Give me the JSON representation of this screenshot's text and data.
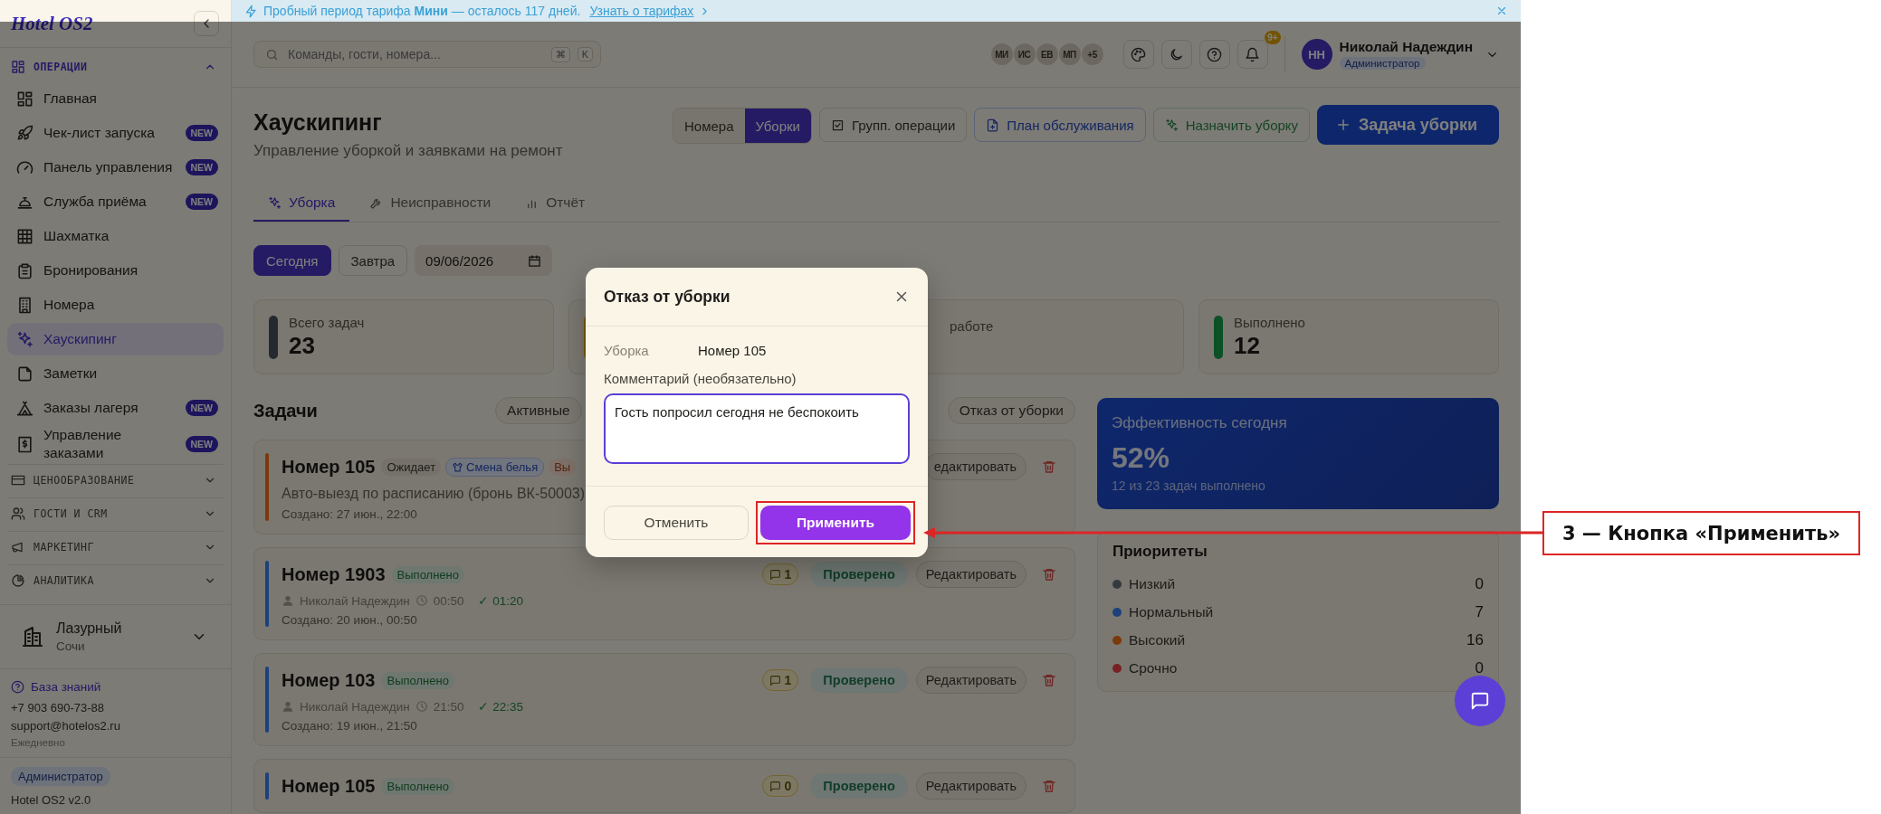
{
  "banner": {
    "text": "Пробный период тарифа **Мини** — осталось 117 дней.",
    "link": "Узнать о тарифах"
  },
  "sidebar": {
    "logo": "Hotel OS2",
    "sections": [
      {
        "label": "ОПЕРАЦИИ",
        "expanded": true,
        "items": [
          {
            "label": "Главная",
            "selected": false
          },
          {
            "label": "Чек-лист запуска",
            "badge": "NEW",
            "selected": false
          },
          {
            "label": "Панель управления",
            "badge": "NEW",
            "selected": false
          },
          {
            "label": "Служба приёма",
            "badge": "NEW",
            "selected": false
          },
          {
            "label": "Шахматка",
            "selected": false
          },
          {
            "label": "Бронирования",
            "selected": false
          },
          {
            "label": "Номера",
            "selected": false
          },
          {
            "label": "Хаускипинг",
            "selected": true
          },
          {
            "label": "Заметки",
            "selected": false
          },
          {
            "label": "Заказы лагеря",
            "badge": "NEW",
            "selected": false
          },
          {
            "label": "Управление заказами",
            "badge": "NEW",
            "selected": false
          }
        ]
      },
      {
        "label": "ЦЕНООБРАЗОВАНИЕ",
        "expanded": false
      },
      {
        "label": "ГОСТИ И CRM",
        "expanded": false
      },
      {
        "label": "МАРКЕТИНГ",
        "expanded": false
      },
      {
        "label": "АНАЛИТИКА",
        "expanded": false
      }
    ],
    "hotel": {
      "name": "Лазурный",
      "city": "Сочи"
    },
    "support": {
      "link": "База знаний",
      "phone": "+7 903 690-73-88",
      "email": "support@hotelos2.ru",
      "hours": "Ежедневно"
    },
    "role": "Администратор",
    "version": "Hotel OS2 v2.0"
  },
  "topbar": {
    "search": {
      "placeholder": "Команды, гости, номера...",
      "keys": [
        "⌘",
        "K"
      ]
    },
    "users": [
      "МИ",
      "ИС",
      "ЕВ",
      "МП",
      "+5"
    ],
    "notifications": "9+",
    "user": {
      "initials": "НН",
      "name": "Николай Надеждин",
      "role": "Администратор"
    }
  },
  "header": {
    "title": "Хаускипинг",
    "subtitle": "Управление уборкой и заявками на ремонт"
  },
  "view_toggle": [
    {
      "label": "Номера",
      "selected": false
    },
    {
      "label": "Уборки",
      "selected": true
    }
  ],
  "actions": [
    {
      "label": "Групп. операции",
      "kind": "outline"
    },
    {
      "label": "План обслуживания",
      "kind": "blue"
    },
    {
      "label": "Назначить уборку",
      "kind": "green"
    },
    {
      "label": "Задача уборки",
      "kind": "primary"
    }
  ],
  "tabs": [
    {
      "label": "Уборка",
      "selected": true
    },
    {
      "label": "Неисправности",
      "selected": false
    },
    {
      "label": "Отчёт",
      "selected": false
    }
  ],
  "days": [
    {
      "label": "Сегодня",
      "selected": true
    },
    {
      "label": "Завтра",
      "selected": false
    }
  ],
  "date": {
    "value": "09/06/2026"
  },
  "stats": [
    {
      "label": "Всего задач",
      "value": "23",
      "color": "#252a31"
    },
    {
      "color": "#755a04"
    },
    {
      "label": "работе",
      "kind": "partial"
    },
    {
      "label": "Выполнено",
      "value": "12",
      "color": "#0b5125"
    }
  ],
  "tasks_title": "Задачи",
  "filters": [
    "Активные",
    "Отказ от уборки"
  ],
  "tasks": [
    {
      "title": "Номер 105",
      "color": "#7c390b",
      "badges": [
        {
          "label": "Ожидает",
          "kind": "waiting"
        },
        {
          "label": "Смена белья",
          "kind": "type"
        },
        {
          "label": "Вы",
          "kind": "priority"
        }
      ],
      "description": "Авто-выезд по расписанию (бронь ВК-50003)",
      "created": "Создано: 27 июн., 22:00",
      "edit": "едактировать"
    },
    {
      "title": "Номер 1903",
      "color": "#1d417b",
      "badges": [
        {
          "label": "Выполнено",
          "kind": "done"
        }
      ],
      "assignee": "Николай Надеждин",
      "start": "00:50",
      "finish": "✓ 01:20",
      "created": "Создано: 20 июн., 00:50",
      "comments": "1",
      "verified": "Проверено",
      "edit": "Редактировать"
    },
    {
      "title": "Номер 103",
      "color": "#1d417b",
      "badges": [
        {
          "label": "Выполнено",
          "kind": "done"
        }
      ],
      "assignee": "Николай Надеждин",
      "start": "21:50",
      "finish": "✓ 22:35",
      "created": "Создано: 19 июн., 21:50",
      "comments": "1",
      "verified": "Проверено",
      "edit": "Редактировать"
    },
    {
      "title": "Номер 105",
      "color": "#1d417b",
      "badges": [
        {
          "label": "Выполнено",
          "kind": "done"
        }
      ],
      "comments": "0",
      "verified": "Проверено",
      "edit": "Редактировать"
    }
  ],
  "efficiency": {
    "title": "Эффективность сегодня",
    "value": "52%",
    "note": "12 из 23 задач выполнено"
  },
  "priorities": {
    "title": "Приоритеты",
    "rows": [
      {
        "label": "Низкий",
        "count": "0",
        "color": "#353940"
      },
      {
        "label": "Нормальный",
        "count": "7",
        "color": "#1d417b"
      },
      {
        "label": "Высокий",
        "count": "16",
        "color": "#7c390b"
      },
      {
        "label": "Срочно",
        "count": "0",
        "color": "#772222"
      }
    ]
  },
  "modal": {
    "title": "Отказ от уборки",
    "field_label": "Уборка",
    "field_value": "Номер 105",
    "comment_label": "Комментарий (необязательно)",
    "comment": "Гость попросил сегодня не беспокоить",
    "cancel": "Отменить",
    "apply": "Применить"
  },
  "annotation": {
    "label": "3 — Кнопка «Применить»"
  }
}
